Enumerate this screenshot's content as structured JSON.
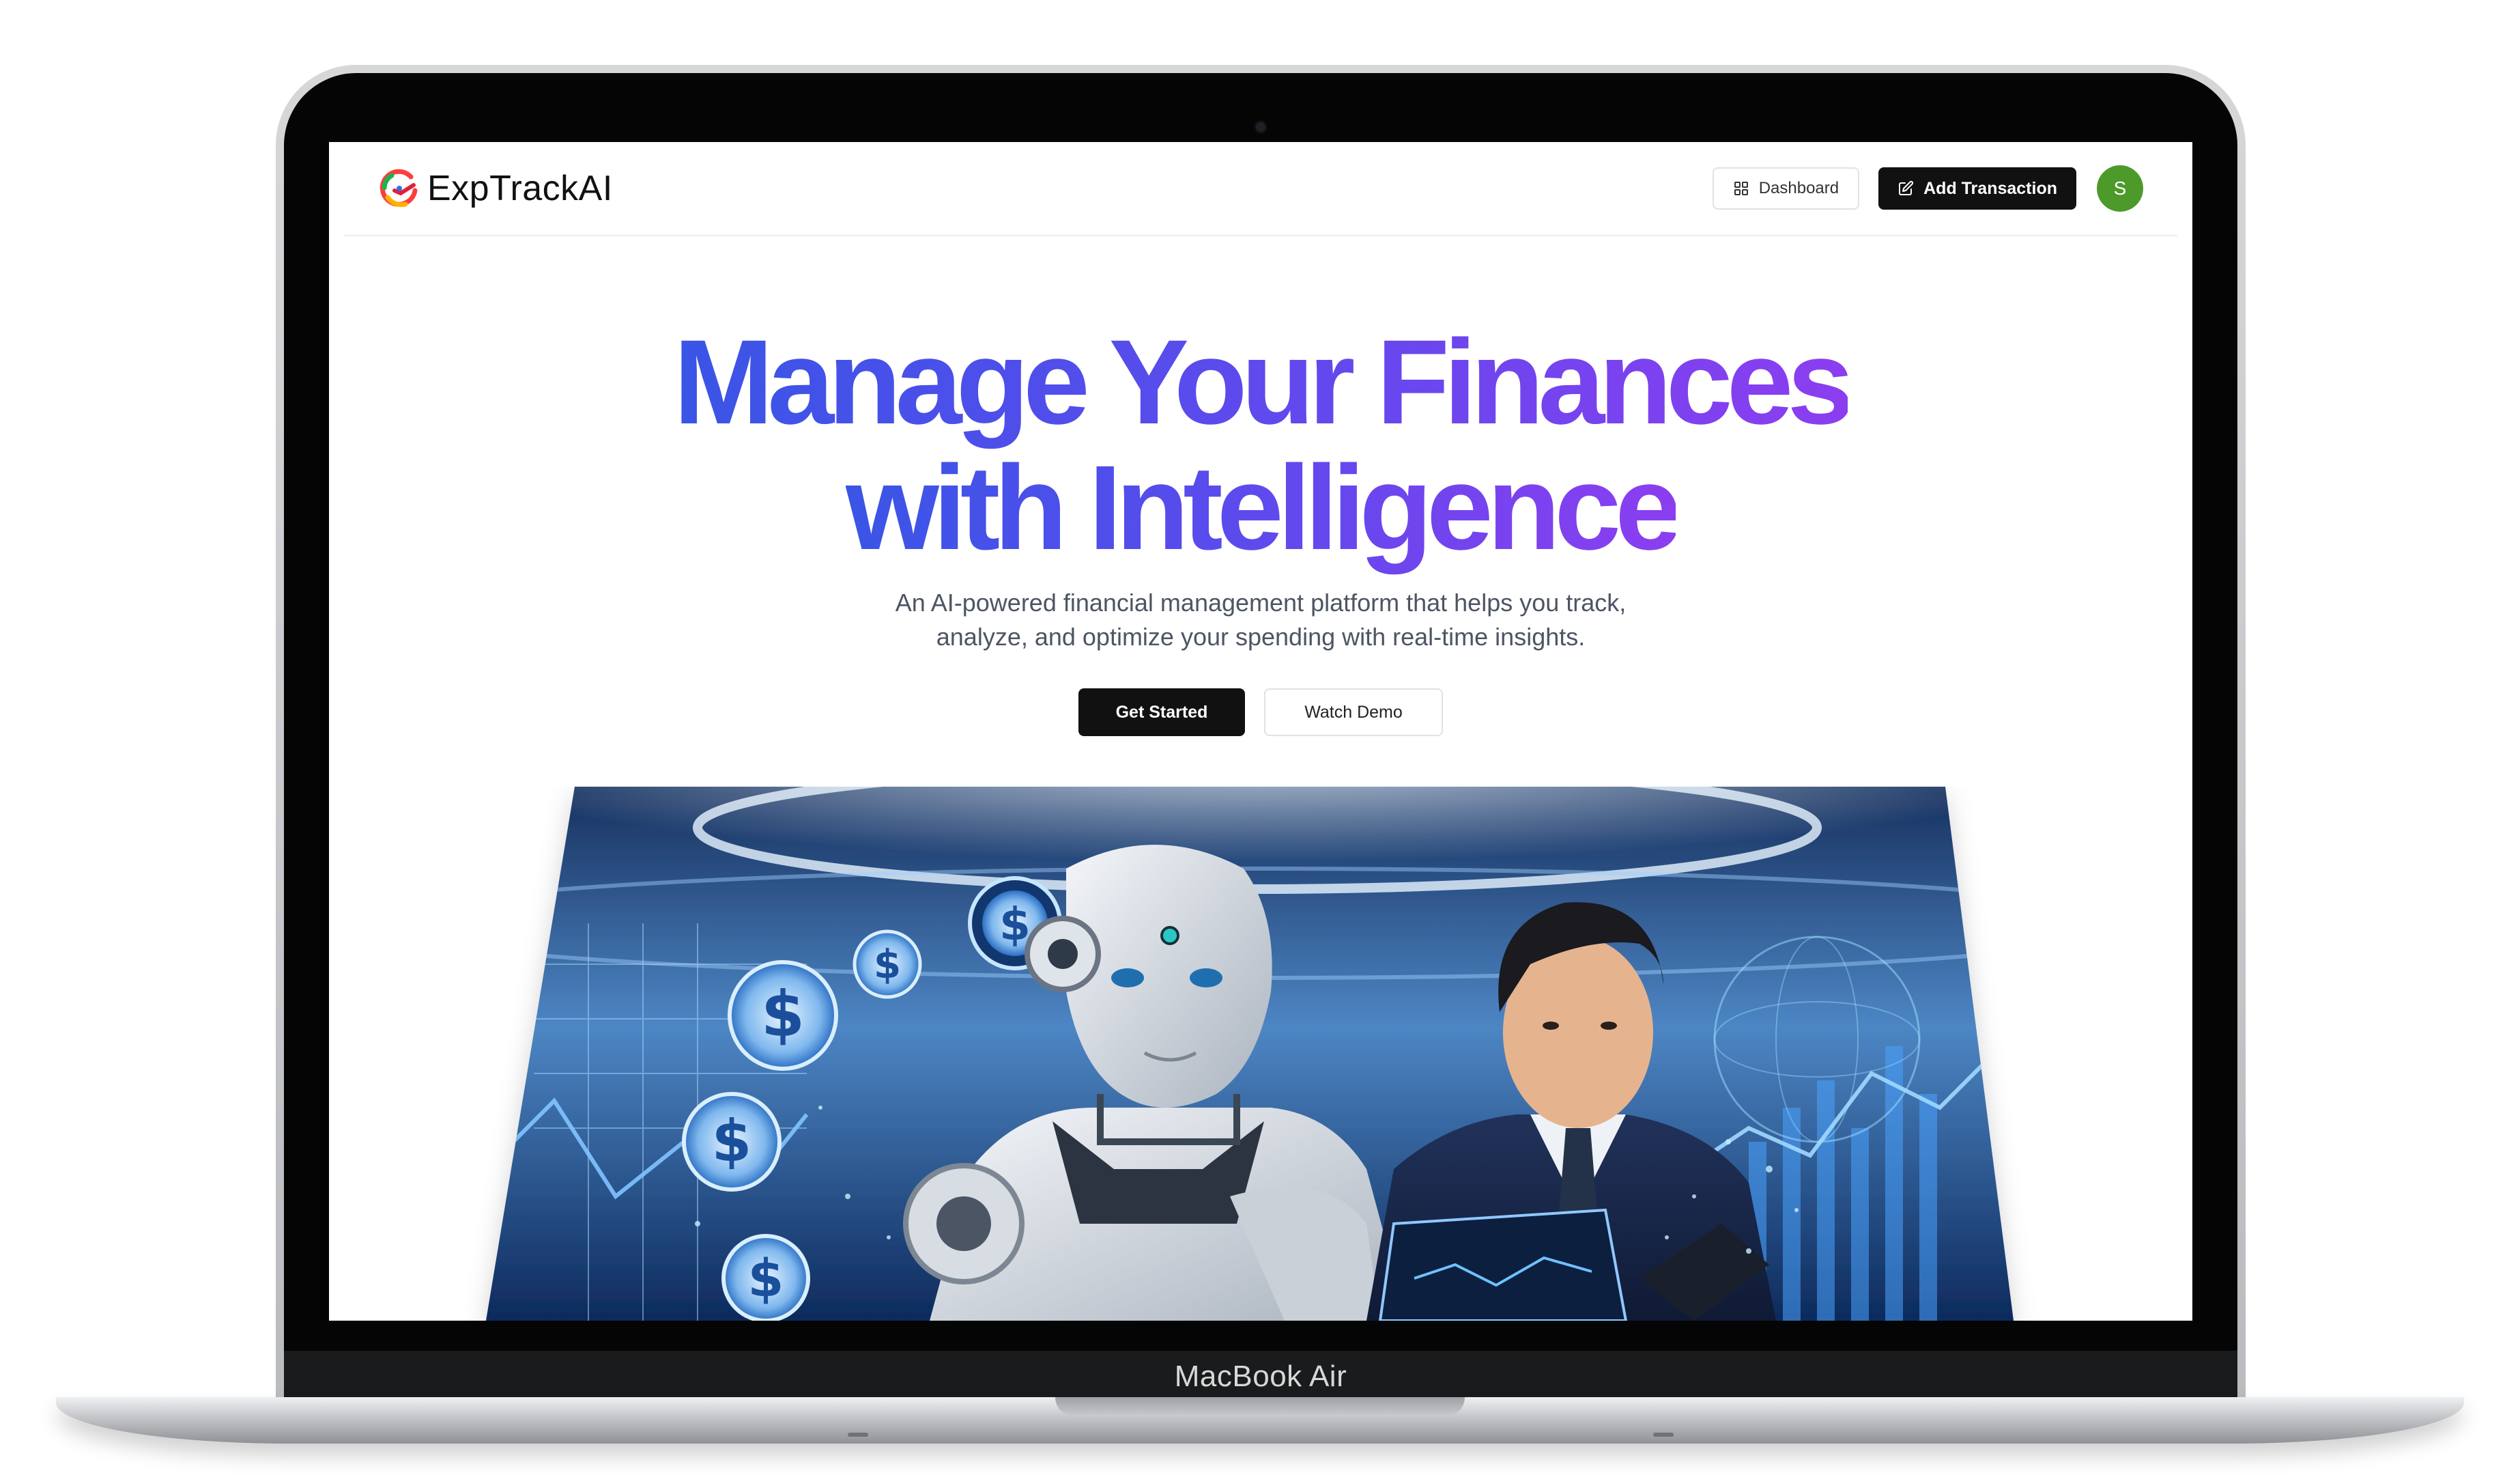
{
  "device": {
    "model_label": "MacBook Air"
  },
  "navbar": {
    "brand_name": "ExpTrackAI",
    "dashboard_label": "Dashboard",
    "add_transaction_label": "Add Transaction",
    "avatar_initial": "S"
  },
  "hero": {
    "title_line1": "Manage Your Finances",
    "title_line2": "with Intelligence",
    "subtitle_line1": "An AI-powered financial management platform that helps you track,",
    "subtitle_line2": "analyze, and optimize your spending with real-time insights.",
    "get_started_label": "Get Started",
    "watch_demo_label": "Watch Demo"
  },
  "icons": {
    "brand": "exptrackai-logo-icon",
    "dashboard": "layout-grid-icon",
    "add_transaction": "pen-square-icon"
  },
  "colors": {
    "title_gradient_start": "#3a55e6",
    "title_gradient_end": "#8b3ef0",
    "primary_button": "#111111",
    "avatar": "#4c9a2a"
  }
}
